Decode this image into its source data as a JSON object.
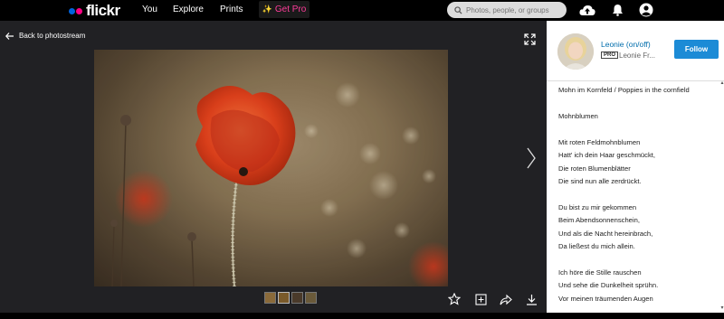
{
  "header": {
    "logo": "flickr",
    "nav": [
      "You",
      "Explore",
      "Prints"
    ],
    "get_pro": "Get Pro",
    "search_placeholder": "Photos, people, or groups"
  },
  "viewer": {
    "back_label": "Back to photostream"
  },
  "owner": {
    "username": "Leonie (on/off)",
    "pro_badge": "PRO",
    "realname": "Leonie Fr...",
    "follow_label": "Follow"
  },
  "description": {
    "title": "Mohn im Kornfeld / Poppies in the cornfield",
    "paragraphs": [
      [
        "Mohnblumen"
      ],
      [
        "Mit roten Feldmohnblumen",
        "Hatt' ich dein Haar geschmückt,",
        "Die roten Blumenblätter",
        "Die sind nun alle zerdrückt."
      ],
      [
        "Du bist zu mir gekommen",
        "Beim Abendsonnenschein,",
        "Und als die Nacht hereinbrach,",
        "Da ließest du mich allein."
      ],
      [
        "Ich höre die Stille rauschen",
        "Und sehe die Dunkelheit sprühn.",
        "Vor meinen träumenden Augen"
      ]
    ]
  },
  "colors": {
    "accent": "#1c8bd6",
    "link": "#006dac",
    "get_pro": "#ff3c9a",
    "viewer_bg": "#212124"
  }
}
